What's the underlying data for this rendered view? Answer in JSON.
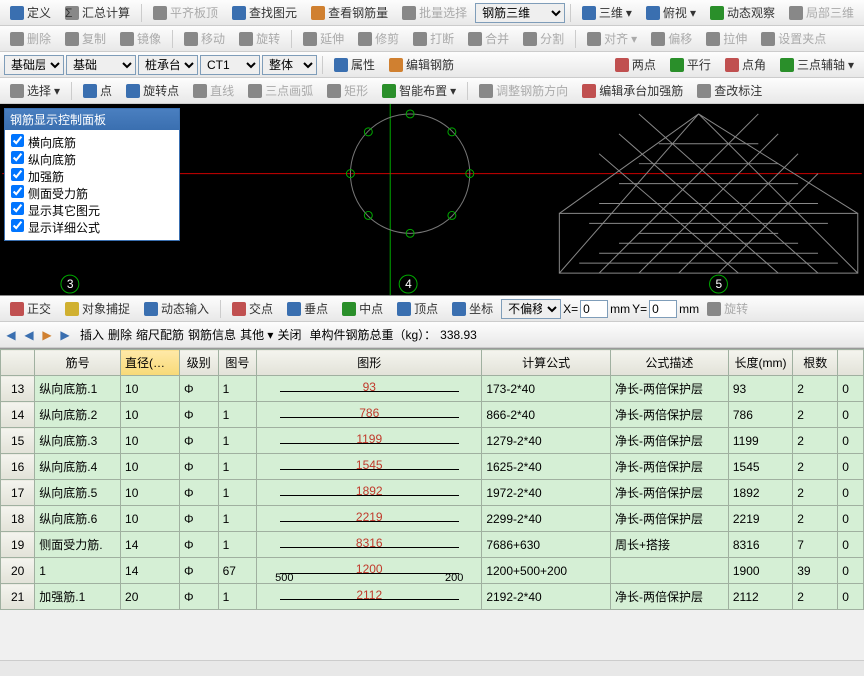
{
  "toolbar1": {
    "define": "定义",
    "sumcalc": "汇总计算",
    "flatboard": "平齐板顶",
    "finddwg": "查找图元",
    "viewrebar": "查看钢筋量",
    "batchselect": "批量选择",
    "dropdown1": "钢筋三维",
    "view3d": "三维",
    "overlook": "俯视",
    "dynamic": "动态观察",
    "local3d": "局部三维"
  },
  "toolbar2": {
    "delete": "删除",
    "copy": "复制",
    "mirror": "镜像",
    "move": "移动",
    "rotate": "旋转",
    "extend": "延伸",
    "trim": "修剪",
    "break": "打断",
    "merge": "合并",
    "split": "分割",
    "align": "对齐",
    "offset": "偏移",
    "stretch": "拉伸",
    "setclamp": "设置夹点"
  },
  "toolbar3": {
    "layer": "基础层",
    "category": "基础",
    "subcat": "桩承台",
    "code": "CT1",
    "mode": "整体",
    "attr": "属性",
    "editrebar": "编辑钢筋",
    "twopoint": "两点",
    "parallel": "平行",
    "pointangle": "点角",
    "threepoint": "三点辅轴"
  },
  "toolbar4": {
    "select": "选择",
    "point": "点",
    "rotpoint": "旋转点",
    "line": "直线",
    "arc3": "三点画弧",
    "rect": "矩形",
    "smart": "智能布置",
    "adjustdir": "调整钢筋方向",
    "editbearing": "编辑承台加强筋",
    "editnote": "查改标注"
  },
  "panel": {
    "title": "钢筋显示控制面板",
    "items": [
      "横向底筋",
      "纵向底筋",
      "加强筋",
      "侧面受力筋",
      "显示其它图元",
      "显示详细公式"
    ]
  },
  "snapbar": {
    "ortho": "正交",
    "objsnap": "对象捕捉",
    "dyninput": "动态输入",
    "intersect": "交点",
    "perp": "垂点",
    "mid": "中点",
    "apex": "顶点",
    "coord": "坐标",
    "nooffset": "不偏移",
    "xlabel": "X=",
    "ylabel": "Y=",
    "mm": "mm",
    "rotate": "旋转"
  },
  "navrow": {
    "insert": "插入",
    "delete": "删除",
    "scale": "缩尺配筋",
    "rebarinfo": "钢筋信息",
    "other": "其他",
    "close": "关闭",
    "totalweight_label": "单构件钢筋总重（kg）：",
    "totalweight": "338.93"
  },
  "grid": {
    "headers": [
      "",
      "筋号",
      "直径(mm)",
      "级别",
      "图号",
      "图形",
      "计算公式",
      "公式描述",
      "长度(mm)",
      "根数",
      ""
    ],
    "rows": [
      {
        "n": "13",
        "name": "纵向底筋.1",
        "dia": "10",
        "grade": "Φ",
        "fig": "1",
        "shapeVal": "93",
        "formula": "173-2*40",
        "desc": "净长-两倍保护层",
        "len": "93",
        "count": "2",
        "extra": "0"
      },
      {
        "n": "14",
        "name": "纵向底筋.2",
        "dia": "10",
        "grade": "Φ",
        "fig": "1",
        "shapeVal": "786",
        "formula": "866-2*40",
        "desc": "净长-两倍保护层",
        "len": "786",
        "count": "2",
        "extra": "0"
      },
      {
        "n": "15",
        "name": "纵向底筋.3",
        "dia": "10",
        "grade": "Φ",
        "fig": "1",
        "shapeVal": "1199",
        "formula": "1279-2*40",
        "desc": "净长-两倍保护层",
        "len": "1199",
        "count": "2",
        "extra": "0"
      },
      {
        "n": "16",
        "name": "纵向底筋.4",
        "dia": "10",
        "grade": "Φ",
        "fig": "1",
        "shapeVal": "1545",
        "formula": "1625-2*40",
        "desc": "净长-两倍保护层",
        "len": "1545",
        "count": "2",
        "extra": "0"
      },
      {
        "n": "17",
        "name": "纵向底筋.5",
        "dia": "10",
        "grade": "Φ",
        "fig": "1",
        "shapeVal": "1892",
        "formula": "1972-2*40",
        "desc": "净长-两倍保护层",
        "len": "1892",
        "count": "2",
        "extra": "0"
      },
      {
        "n": "18",
        "name": "纵向底筋.6",
        "dia": "10",
        "grade": "Φ",
        "fig": "1",
        "shapeVal": "2219",
        "formula": "2299-2*40",
        "desc": "净长-两倍保护层",
        "len": "2219",
        "count": "2",
        "extra": "0"
      },
      {
        "n": "19",
        "name": "侧面受力筋.",
        "dia": "14",
        "grade": "Φ",
        "fig": "1",
        "shapeVal": "8316",
        "formula": "7686+630",
        "desc": "周长+搭接",
        "len": "8316",
        "count": "7",
        "extra": "0"
      },
      {
        "n": "20",
        "name": "1",
        "dia": "14",
        "grade": "Φ",
        "fig": "67",
        "shapeVal": "1200",
        "shapeL": "500",
        "shapeR": "200",
        "formula": "1200+500+200",
        "desc": "",
        "len": "1900",
        "count": "39",
        "extra": "0"
      },
      {
        "n": "21",
        "name": "加强筋.1",
        "dia": "20",
        "grade": "Φ",
        "fig": "1",
        "shapeVal": "2112",
        "formula": "2192-2*40",
        "desc": "净长-两倍保护层",
        "len": "2112",
        "count": "2",
        "extra": "0"
      }
    ]
  }
}
